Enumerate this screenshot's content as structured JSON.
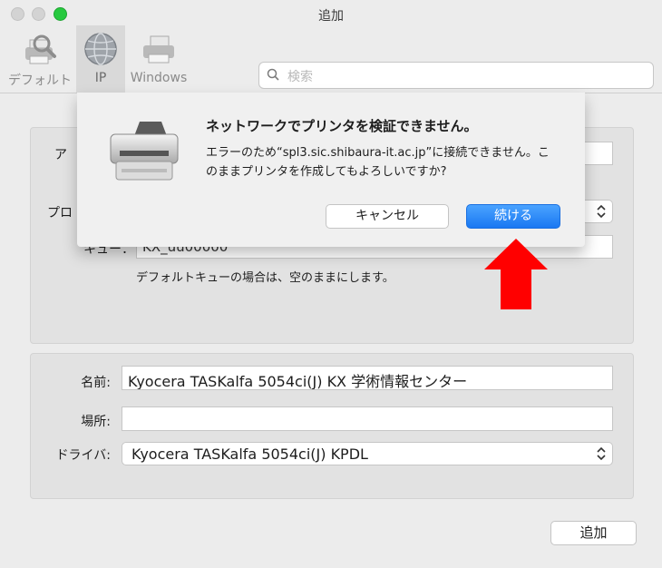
{
  "window": {
    "title": "追加"
  },
  "toolbar": {
    "items": [
      {
        "label": "デフォルト",
        "icon": "default-printer-icon"
      },
      {
        "label": "IP",
        "icon": "globe-icon",
        "selected": true
      },
      {
        "label": "Windows",
        "icon": "windows-printer-icon"
      }
    ],
    "search": {
      "placeholder": "検索",
      "label": "検索"
    }
  },
  "top_panel": {
    "address_label": "ア",
    "protocol_label": "プロ",
    "queue_label": "キュー：",
    "queue_value": "KX_uu00000",
    "queue_hint": "デフォルトキューの場合は、空のままにします。"
  },
  "bottom_panel": {
    "name_label": "名前:",
    "name_value": "Kyocera TASKalfa 5054ci(J) KX 学術情報センター",
    "location_label": "場所:",
    "location_value": "",
    "driver_label": "ドライバ:",
    "driver_value": "Kyocera TASKalfa 5054ci(J) KPDL"
  },
  "add_button": "追加",
  "dialog": {
    "title": "ネットワークでプリンタを検証できません。",
    "message": "エラーのため“spl3.sic.shibaura-it.ac.jp”に接続できません。このままプリンタを作成してもよろしいですか?",
    "cancel_label": "キャンセル",
    "continue_label": "続ける"
  },
  "colors": {
    "accent": "#1a78f2",
    "annotation_arrow": "#ff0000"
  }
}
